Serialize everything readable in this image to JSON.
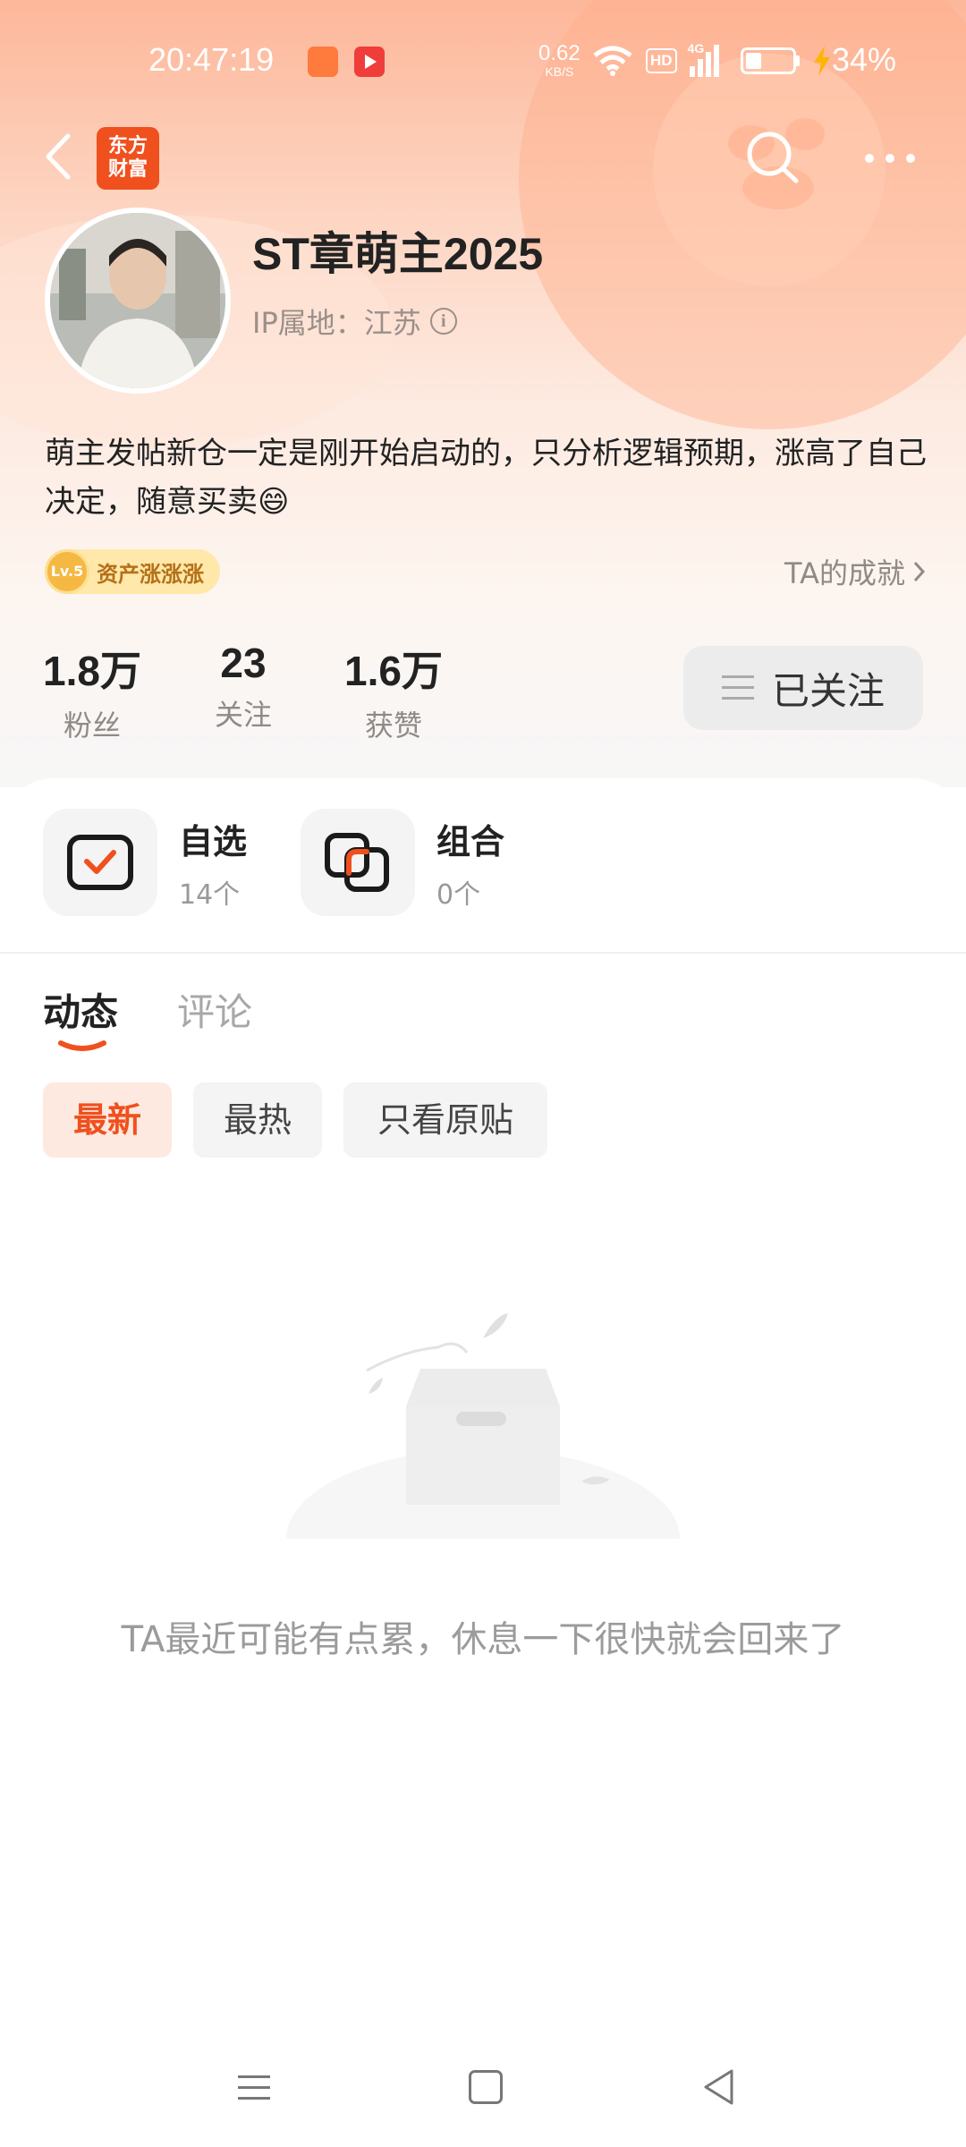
{
  "status_bar": {
    "time": "20:47:19",
    "net_speed_value": "0.62",
    "net_speed_unit": "KB/S",
    "hd_label": "HD",
    "network_label": "4G",
    "battery_percent": "34%",
    "battery_level": 0.34
  },
  "header": {
    "app_logo_line1": "东方",
    "app_logo_line2": "财富"
  },
  "profile": {
    "username": "ST章萌主2025",
    "ip_location": "IP属地：江苏",
    "bio": "萌主发帖新仓一定是刚开始启动的，只分析逻辑预期，涨高了自己决定，随意买卖😄",
    "level_label": "Lv.5",
    "level_title": "资产涨涨涨",
    "achievement_link": "TA的成就"
  },
  "stats": [
    {
      "value": "1.8万",
      "label": "粉丝"
    },
    {
      "value": "23",
      "label": "关注"
    },
    {
      "value": "1.6万",
      "label": "获赞"
    }
  ],
  "follow_button": {
    "label": "已关注"
  },
  "cards": [
    {
      "title": "自选",
      "count": "14个"
    },
    {
      "title": "组合",
      "count": "0个"
    }
  ],
  "tabs": [
    {
      "label": "动态",
      "active": true
    },
    {
      "label": "评论",
      "active": false
    }
  ],
  "filters": [
    {
      "label": "最新",
      "active": true
    },
    {
      "label": "最热",
      "active": false
    },
    {
      "label": "只看原贴",
      "active": false
    }
  ],
  "empty_state": {
    "message": "TA最近可能有点累，休息一下很快就会回来了"
  },
  "colors": {
    "accent": "#f0501e",
    "header_gradient_top": "#fdb79a"
  }
}
